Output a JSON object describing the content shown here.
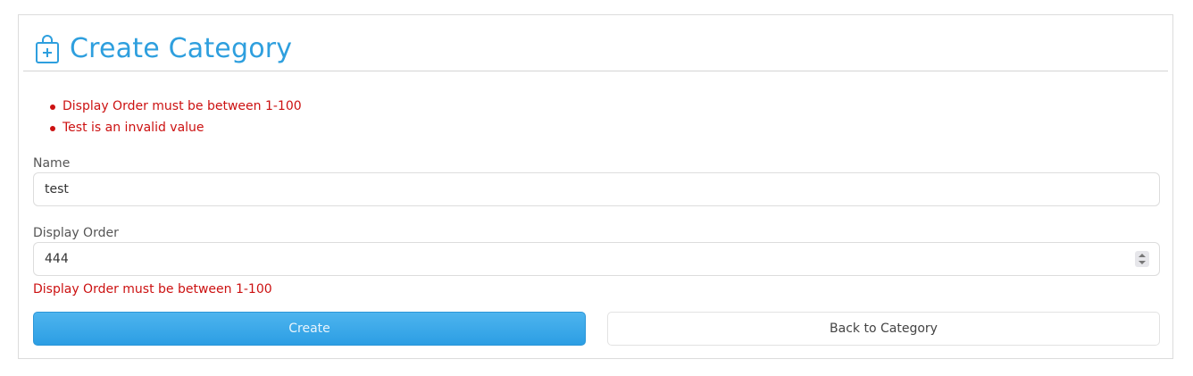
{
  "header": {
    "title": "Create Category",
    "icon": "bag-plus-icon",
    "title_color": "#2e9fde"
  },
  "validation_summary": {
    "errors": [
      "Display Order must be between 1-100",
      "Test is an invalid value"
    ],
    "error_color": "#cc1111"
  },
  "form": {
    "name": {
      "label": "Name",
      "value": "test"
    },
    "display_order": {
      "label": "Display Order",
      "value": "444",
      "error": "Display Order must be between 1-100"
    }
  },
  "actions": {
    "create_label": "Create",
    "back_label": "Back to Category"
  }
}
